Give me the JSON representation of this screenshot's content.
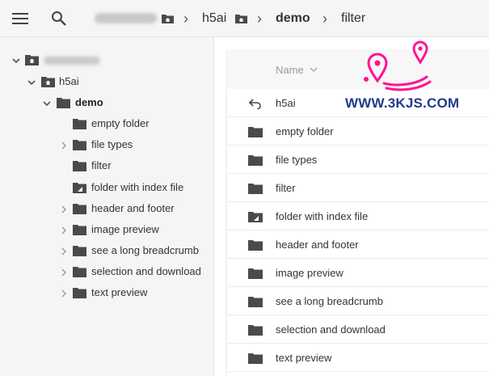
{
  "toolbar": {
    "menu_icon": "hamburger-menu-icon",
    "search_icon": "search-icon"
  },
  "breadcrumb": {
    "items": [
      {
        "label": "",
        "blurred": true
      },
      {
        "label": "h5ai"
      },
      {
        "label": "demo",
        "bold": true
      },
      {
        "label": "filter"
      }
    ]
  },
  "sidebar": {
    "tree": [
      {
        "label": "",
        "blurred": true,
        "expanded": true
      },
      {
        "label": "h5ai",
        "expanded": true
      },
      {
        "label": "demo",
        "expanded": true,
        "bold": true
      },
      {
        "label": "empty folder"
      },
      {
        "label": "file types",
        "collapsible": true
      },
      {
        "label": "filter"
      },
      {
        "label": "folder with index file",
        "index_file": true
      },
      {
        "label": "header and footer",
        "collapsible": true
      },
      {
        "label": "image preview",
        "collapsible": true
      },
      {
        "label": "see a long breadcrumb",
        "collapsible": true
      },
      {
        "label": "selection and download",
        "collapsible": true
      },
      {
        "label": "text preview",
        "collapsible": true
      }
    ]
  },
  "listing": {
    "header": {
      "name": "Name",
      "sort_icon": "chevron-down-icon"
    },
    "rows": [
      {
        "label": "h5ai",
        "icon": "back-arrow-icon"
      },
      {
        "label": "empty folder",
        "icon": "folder-icon"
      },
      {
        "label": "file types",
        "icon": "folder-icon"
      },
      {
        "label": "filter",
        "icon": "folder-icon"
      },
      {
        "label": "folder with index file",
        "icon": "folder-page-icon"
      },
      {
        "label": "header and footer",
        "icon": "folder-icon"
      },
      {
        "label": "image preview",
        "icon": "folder-icon"
      },
      {
        "label": "see a long breadcrumb",
        "icon": "folder-icon"
      },
      {
        "label": "selection and download",
        "icon": "folder-icon"
      },
      {
        "label": "text preview",
        "icon": "folder-icon"
      }
    ]
  },
  "watermark": {
    "text": "WWW.3KJS.COM"
  },
  "colors": {
    "folder": "#4a4a4a",
    "watermark_pink": "#ff1493",
    "watermark_blue": "#1f3c8a"
  }
}
